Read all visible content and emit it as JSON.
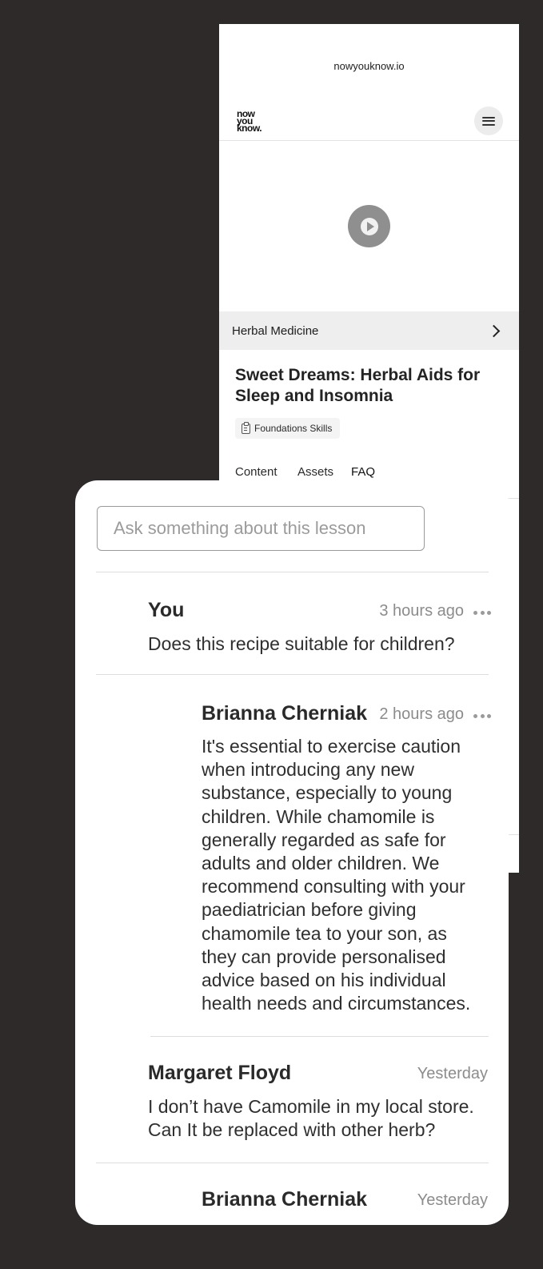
{
  "browser": {
    "url": "nowyouknow.io"
  },
  "site": {
    "logo_lines": [
      "now",
      "you",
      "know."
    ],
    "menu_icon": "hamburger-menu-icon"
  },
  "video": {
    "play_icon": "play-icon"
  },
  "category": {
    "label": "Herbal Medicine",
    "chevron_icon": "chevron-right-icon"
  },
  "lesson": {
    "title": "Sweet Dreams: Herbal Aids for Sleep and Insomnia",
    "badge": "Foundations Skills",
    "badge_icon": "clipboard-icon"
  },
  "tabs": [
    {
      "label": "Content",
      "active": false
    },
    {
      "label": "Assets",
      "active": false
    },
    {
      "label": "FAQ",
      "active": true
    }
  ],
  "faq": {
    "input_placeholder": "Ask something about this lesson",
    "messages": [
      {
        "author": "You",
        "time": "3 hours ago",
        "has_more_menu": true,
        "text": "Does this recipe suitable for children?"
      },
      {
        "author": "Brianna Cherniak",
        "time": "2 hours ago",
        "has_more_menu": true,
        "text": "It's essential to exercise caution when introducing any new substance, especially to young children. While chamomile is generally regarded as safe for adults and older children. We recommend consulting with your paediatrician before giving chamomile tea to your son, as they can provide personalised advice based on his individual health needs and circumstances."
      },
      {
        "author": "Margaret Floyd",
        "time": "Yesterday",
        "has_more_menu": false,
        "text": "I don’t have Camomile in my local store. Can It be replaced with other herb?"
      },
      {
        "author": "Brianna Cherniak",
        "time": "Yesterday",
        "has_more_menu": false,
        "text": ""
      }
    ]
  },
  "colors": {
    "background": "#2d2a29",
    "panel": "#ffffff",
    "category_bar": "#eeeeee",
    "muted_text": "#8c8c8c",
    "play_button": "#8f8f8f"
  }
}
